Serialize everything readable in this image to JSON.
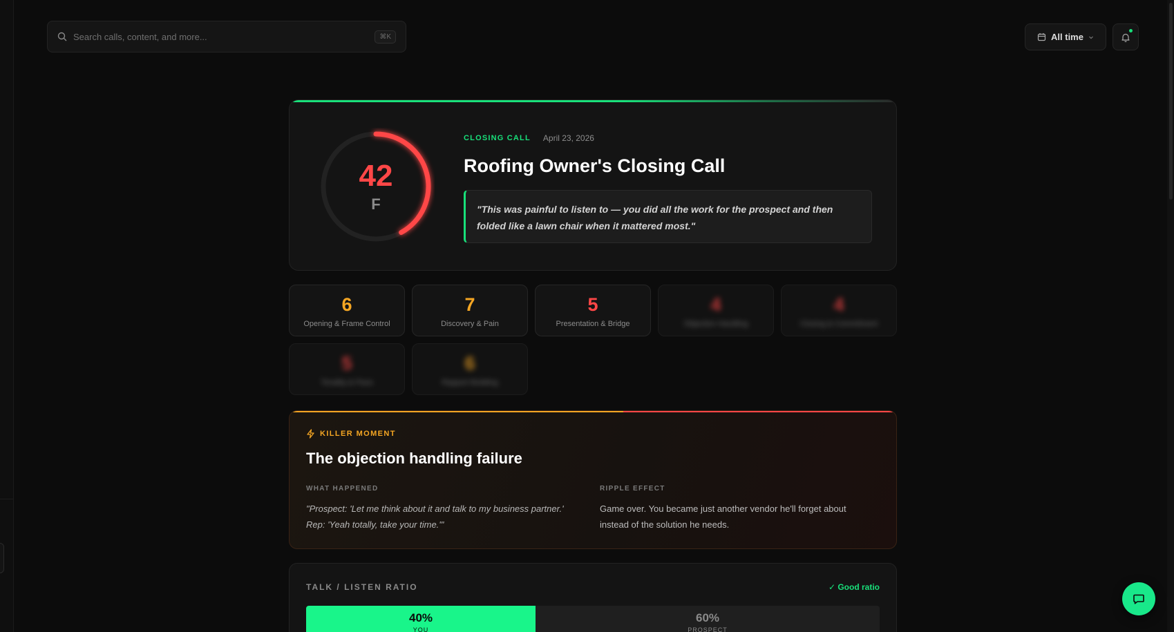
{
  "search": {
    "placeholder": "Search calls, content, and more...",
    "shortcut": "⌘K",
    "icon": "search-icon"
  },
  "header": {
    "time_filter_label": "All time",
    "time_filter_icon": "calendar-icon",
    "notifications_icon": "bell-icon"
  },
  "call": {
    "type_tag": "CLOSING CALL",
    "date": "April 23, 2026",
    "title": "Roofing Owner's Closing Call",
    "quote": "\"This was painful to listen to — you did all the work for the prospect and then folded like a lawn chair when it mattered most.\"",
    "score": "42",
    "score_max": 100,
    "grade": "F",
    "accent": "#18e07a",
    "score_color": "#ff4747"
  },
  "categories": [
    {
      "value": "6",
      "label": "Opening & Frame Control",
      "color": "#f5a623",
      "locked": false
    },
    {
      "value": "7",
      "label": "Discovery & Pain",
      "color": "#f5a623",
      "locked": false
    },
    {
      "value": "5",
      "label": "Presentation & Bridge",
      "color": "#ff4747",
      "locked": false
    },
    {
      "value": "4",
      "label": "Objection Handling",
      "color": "#ff4747",
      "locked": true
    },
    {
      "value": "4",
      "label": "Closing & Commitment",
      "color": "#ff4747",
      "locked": true
    },
    {
      "value": "5",
      "label": "Tonality & Pace",
      "color": "#ff4747",
      "locked": true
    },
    {
      "value": "6",
      "label": "Rapport Building",
      "color": "#f5a623",
      "locked": true
    }
  ],
  "killer_moment": {
    "tag": "KILLER MOMENT",
    "title": "The objection handling failure",
    "what_happened_label": "WHAT HAPPENED",
    "what_happened": "\"Prospect: 'Let me think about it and talk to my business partner.' Rep: 'Yeah totally, take your time.'\"",
    "ripple_label": "RIPPLE EFFECT",
    "ripple": "Game over. You became just another vendor he'll forget about instead of the solution he needs."
  },
  "talk_ratio": {
    "title": "TALK / LISTEN RATIO",
    "status": "✓ Good ratio",
    "you_pct_label": "40%",
    "you_pct": 40,
    "you_label": "YOU",
    "prospect_pct_label": "60%",
    "prospect_label": "PROSPECT"
  },
  "chat": {
    "icon": "chat-icon"
  }
}
